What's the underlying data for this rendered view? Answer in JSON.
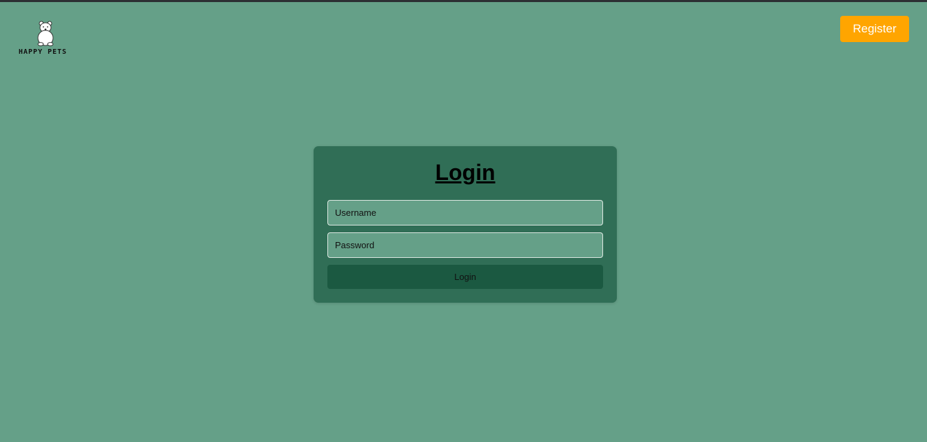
{
  "brand": {
    "name": "HAPPY PETS",
    "logo_icon": "bear-icon"
  },
  "header": {
    "register_label": "Register"
  },
  "login_form": {
    "title": "Login",
    "username_placeholder": "Username",
    "username_value": "",
    "password_placeholder": "Password",
    "password_value": "",
    "submit_label": "Login"
  },
  "colors": {
    "background": "#65a088",
    "card": "#306e56",
    "submit_button": "#1b5941",
    "register_button": "#ffa500"
  }
}
